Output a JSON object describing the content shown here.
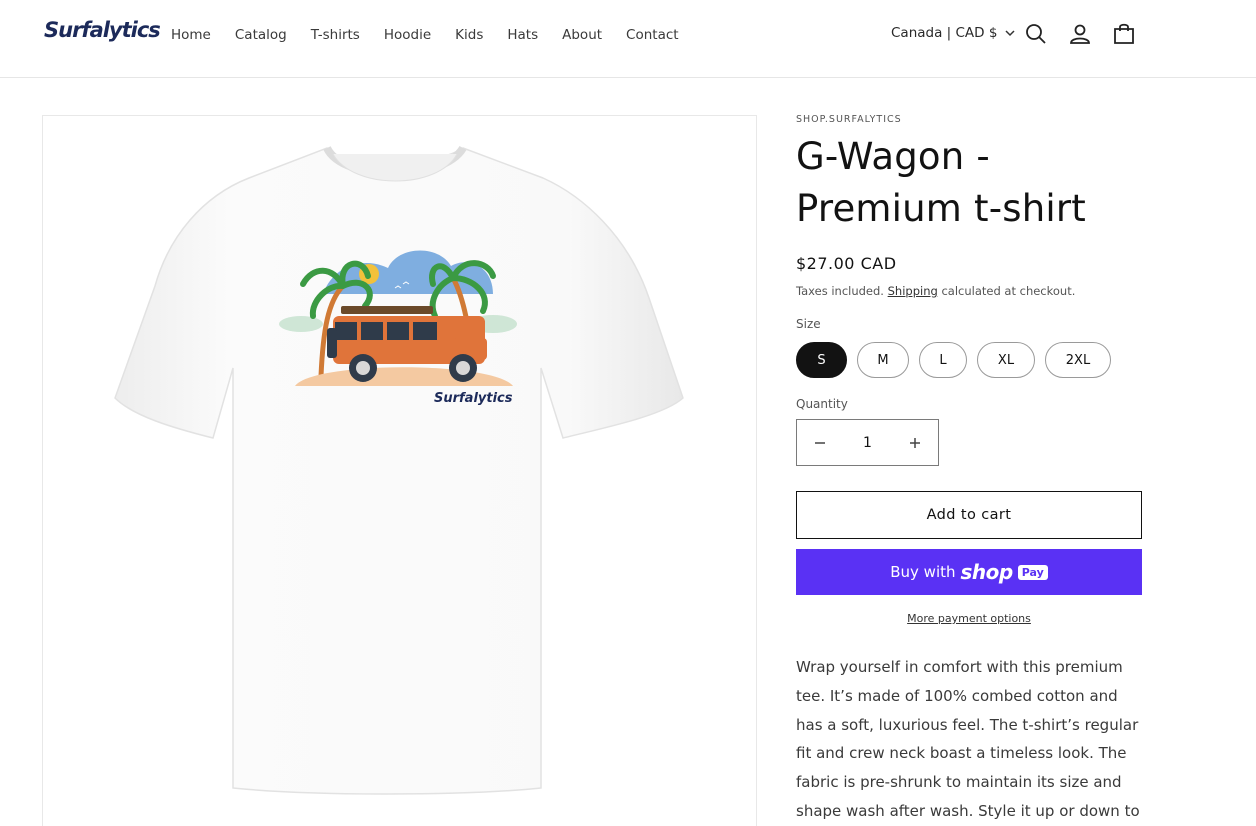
{
  "header": {
    "logo": "Surfalytics",
    "nav": [
      "Home",
      "Catalog",
      "T-shirts",
      "Hoodie",
      "Kids",
      "Hats",
      "About",
      "Contact"
    ],
    "country": "Canada | CAD $",
    "icons": [
      "search-icon",
      "account-icon",
      "cart-icon"
    ]
  },
  "product": {
    "image_brand": "Surfalytics",
    "vendor": "SHOP.SURFALYTICS",
    "title": "G-Wagon - Premium t-shirt",
    "price": "$27.00 CAD",
    "tax_prefix": "Taxes included.",
    "tax_link": "Shipping",
    "tax_suffix": "calculated at checkout.",
    "size_label": "Size",
    "sizes": [
      "S",
      "M",
      "L",
      "XL",
      "2XL"
    ],
    "selected_size": "S",
    "quantity_label": "Quantity",
    "quantity": "1",
    "add_to_cart": "Add to cart",
    "buy_with": "Buy with",
    "shop_text": "shop",
    "pay_text": "Pay",
    "more_payment": "More payment options",
    "description": "Wrap yourself in comfort with this premium tee. It’s made of 100% combed cotton and has a soft, luxurious feel. The t-shirt’s regular fit and crew neck boast a timeless look. The fabric is pre-shrunk to maintain its size and shape wash after wash. Style it up or down to suit any"
  },
  "colors": {
    "brand": "#1c2a5a",
    "shop_pay": "#5a31f4",
    "car": "#e0743a"
  }
}
